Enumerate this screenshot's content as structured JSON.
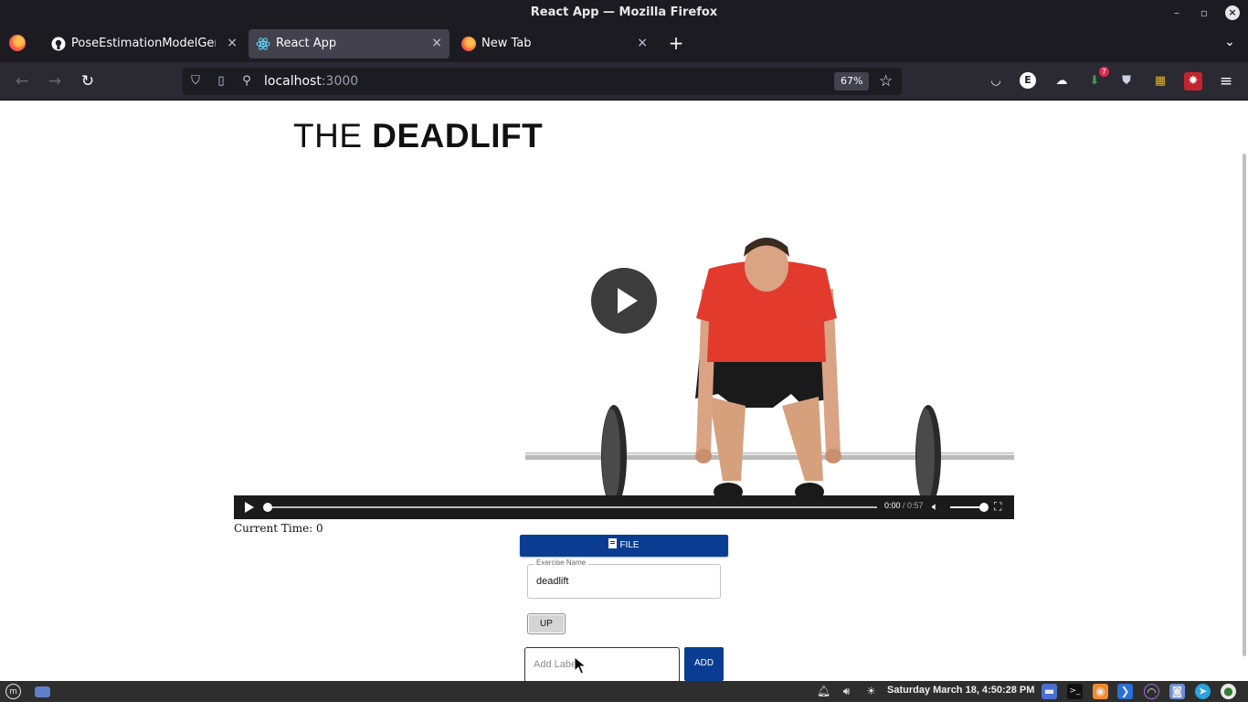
{
  "window": {
    "title": "React App — Mozilla Firefox",
    "controls": {
      "minimize": "–",
      "restore": "▫",
      "close": "×"
    }
  },
  "tabs": [
    {
      "label": "PoseEstimationModelGener",
      "icon": "github-icon",
      "active": false,
      "close": "×"
    },
    {
      "label": "React App",
      "icon": "react-icon",
      "active": true,
      "close": "×"
    },
    {
      "label": "New Tab",
      "icon": "firefox-icon",
      "active": false,
      "close": "×"
    }
  ],
  "newtab_symbol": "+",
  "tablist_symbol": "⌄",
  "nav": {
    "url_host": "localhost",
    "url_port": ":3000",
    "zoom": "67%",
    "back": "←",
    "forward": "→",
    "reload": "↻",
    "star": "☆",
    "menu": "≡"
  },
  "extensions": [
    {
      "name": "pocket-icon",
      "glyph": "◡"
    },
    {
      "name": "extension-e-icon",
      "glyph": "E"
    },
    {
      "name": "cloud-icon",
      "glyph": "☁"
    },
    {
      "name": "download-icon",
      "glyph": "⬇",
      "badge": "7"
    },
    {
      "name": "shield-extension-icon",
      "glyph": "⛊"
    },
    {
      "name": "multicolor-extension-icon",
      "glyph": "▦"
    },
    {
      "name": "red-extension-icon",
      "glyph": "✸"
    }
  ],
  "page": {
    "title_thin": "THE",
    "title_bold": "DEADLIFT",
    "video": {
      "current": "0:00",
      "duration": "/ 0:57",
      "progress": 0.0,
      "volume": 1.0
    },
    "current_time_label": "Current Time: ",
    "current_time_value": "0",
    "file_button": "FILE",
    "exercise_field": {
      "legend": "Exercise Name",
      "value": "deadlift"
    },
    "up_button": "UP",
    "label_input": {
      "placeholder": "Add Label"
    },
    "add_button": "ADD"
  },
  "taskbar": {
    "clock": "Saturday March 18,  4:50:28 PM"
  },
  "colors": {
    "accent": "#0a3d91",
    "chrome_dark": "#1c1b22",
    "chrome_mid": "#2b2a33",
    "tab_active": "#42414d"
  }
}
